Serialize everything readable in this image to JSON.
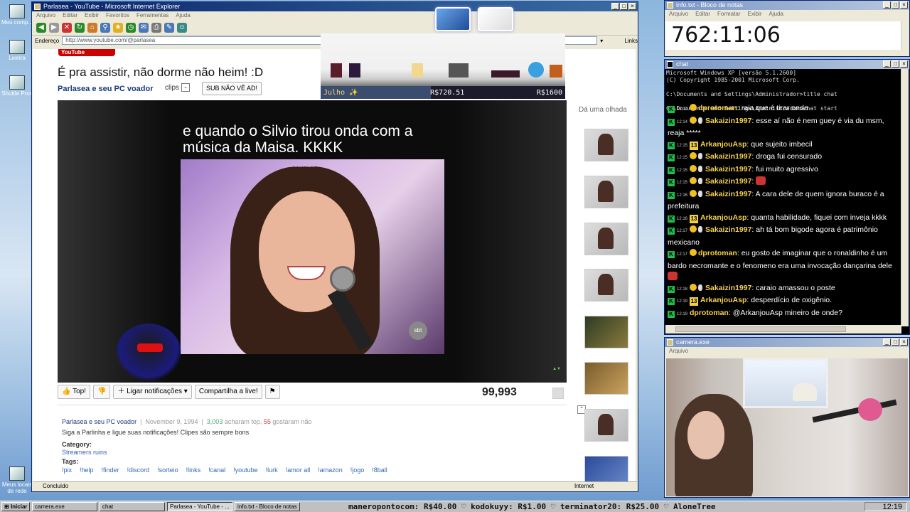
{
  "desktop": {
    "icons": [
      "Meu comp...",
      "Lixeira",
      "Shuttle Prox",
      "Meus locais de rede"
    ]
  },
  "ie": {
    "title": "Parlasea - YouTube - Microsoft Internet Explorer",
    "menu": [
      "Arquivo",
      "Editar",
      "Exibir",
      "Favoritos",
      "Ferramentas",
      "Ajuda"
    ],
    "address_label": "Endereço",
    "url": "http://www.youtube.com/@parlasea",
    "links_label": "Links",
    "status_left": "Concluído",
    "status_zone": "Internet"
  },
  "youtube": {
    "logo": "YouTube",
    "video_title": "É pra assistir, não dorme não heim! :D",
    "channel": "Parlasea e seu PC voador",
    "clips_label": "clips",
    "sub_button": "SUB NÃO VÊ AD!",
    "caption": "e quando o Silvio tirou onda com a música da Maisa. KKKK",
    "watermark": "planetairado",
    "sbt_logo": "sbt",
    "actions": {
      "top": "Top!",
      "notify": "Ligar notificações",
      "share": "Compartilha a live!"
    },
    "views": "99,993",
    "meta": {
      "channel": "Parlasea e seu PC voador",
      "date": "November 9, 1994",
      "likes": "3,003",
      "likes_text": "acharam top,",
      "dislikes": "55",
      "dislikes_text": "gostaram não"
    },
    "description": "Siga a Parlinha e ligue suas notificações! Clipes são sempre bons",
    "category_label": "Category:",
    "category_value": "Streamers ruins",
    "tags_label": "Tags:",
    "tags": [
      "!pix",
      "!help",
      "!finder",
      "!discord",
      "!sorteio",
      "!links",
      "!canal",
      "!youtube",
      "!lurk",
      "!amor all",
      "!amazon",
      "!jogo",
      "!8ball"
    ],
    "sidebar_label": "Dá uma olhada"
  },
  "overlay": {
    "month": "Julho",
    "current": "R$720.51",
    "goal": "R$1600",
    "progress": 0.45
  },
  "notepad": {
    "title": "info.txt - Bloco de notas",
    "menu": [
      "Arquivo",
      "Editar",
      "Formatar",
      "Exibir",
      "Ajuda"
    ],
    "content": "762:11:06"
  },
  "chat": {
    "title": "chat",
    "cmd": "Microsoft Windows XP [versão 5.1.2600]\n(C) Copyright 1985-2001 Microsoft Corp.\n\nC:\\Documents and Settings\\Administrador>title chat\n\nC:\\Documents and Settings\\Administrador>chat start",
    "messages": [
      {
        "time": "12:14",
        "badge": "dot",
        "user": "dprotoman",
        "color": "#f5d24b",
        "text": "raia que é tirar onda"
      },
      {
        "time": "12:14",
        "badge": "dot2",
        "user": "Sakaizin1997",
        "color": "#f5d24b",
        "text": "esse aí não é nem guey é via du msm, reaja *****"
      },
      {
        "time": "12:15",
        "badge": "num",
        "user": "ArkanjouAsp",
        "color": "#f5d24b",
        "text": "que sujeito imbecil"
      },
      {
        "time": "12:15",
        "badge": "dot2",
        "user": "Sakaizin1997",
        "color": "#f5d24b",
        "text": "droga fui censurado"
      },
      {
        "time": "12:15",
        "badge": "dot2",
        "user": "Sakaizin1997",
        "color": "#f5d24b",
        "text": "fui muito agressivo"
      },
      {
        "time": "12:15",
        "badge": "dot2",
        "user": "Sakaizin1997",
        "color": "#f5d24b",
        "text": ""
      },
      {
        "time": "12:16",
        "badge": "dot2",
        "user": "Sakaizin1997",
        "color": "#f5d24b",
        "text": "A cara dele de quem ignora buraco é a prefeitura"
      },
      {
        "time": "12:16",
        "badge": "num",
        "user": "ArkanjouAsp",
        "color": "#f5d24b",
        "text": "quanta habilidade, fiquei com inveja kkkk"
      },
      {
        "time": "12:17",
        "badge": "dot2",
        "user": "Sakaizin1997",
        "color": "#f5d24b",
        "text": "ah tá bom bigode agora é patrimônio mexicano"
      },
      {
        "time": "12:17",
        "badge": "dot",
        "user": "dprotoman",
        "color": "#f5d24b",
        "text": "eu gosto de imaginar que o ronaldinho é um bardo necromante e o fenomeno era uma invocação dançarina dele"
      },
      {
        "time": "12:18",
        "badge": "dot2",
        "user": "Sakaizin1997",
        "color": "#f5d24b",
        "text": "caraio amassou o poste"
      },
      {
        "time": "12:19",
        "badge": "num",
        "user": "ArkanjouAsp",
        "color": "#f5d24b",
        "text": "desperdício de oxigênio."
      },
      {
        "time": "12:19",
        "badge": "none",
        "user": "dprotoman",
        "color": "#f5d24b",
        "text": "@ArkanjouAsp mineiro de onde?"
      }
    ],
    "badge_number": "13"
  },
  "camera": {
    "title": "camera.exe",
    "menu": "Arquivo"
  },
  "taskbar": {
    "start": "Iniciar",
    "apps": [
      "camera.exe",
      "chat",
      "Parlasea - YouTube - ...",
      "info.txt - Bloco de notas"
    ],
    "ticker": "maneropontocom: R$40.00  ♡ kodokuyy: R$1.00  ♡ terminator20: R$25.00  ♡ AloneTree",
    "clock": "12:19"
  }
}
